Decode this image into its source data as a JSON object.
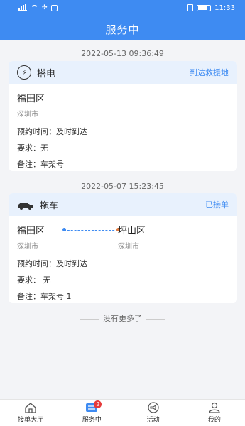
{
  "status_bar": {
    "time": "11:33"
  },
  "header": {
    "title": "服务中"
  },
  "orders": [
    {
      "timestamp": "2022-05-13 09:36:49",
      "service": "搭电",
      "status": "到达救援地",
      "from": {
        "district": "福田区",
        "city": "深圳市"
      },
      "appointment_label": "预约时间：",
      "appointment_value": "及时到达",
      "requirement_label": "要求：",
      "requirement_value": "无",
      "note_label": "备注：",
      "note_value": "车架号"
    },
    {
      "timestamp": "2022-05-07 15:23:45",
      "service": "拖车",
      "status": "已接单",
      "from": {
        "district": "福田区",
        "city": "深圳市"
      },
      "to": {
        "district": "坪山区",
        "city": "深圳市"
      },
      "appointment_label": "预约时间：",
      "appointment_value": "及时到达",
      "requirement_label": "要求：",
      "requirement_value": " 无",
      "note_label": "备注：",
      "note_value": "车架号 1"
    }
  ],
  "list_end": "没有更多了",
  "tabs": [
    {
      "label": "接单大厅",
      "icon": "home-icon"
    },
    {
      "label": "服务中",
      "icon": "list-icon",
      "badge": "2",
      "active": true
    },
    {
      "label": "活动",
      "icon": "megaphone-icon"
    },
    {
      "label": "我的",
      "icon": "user-icon"
    }
  ],
  "colors": {
    "primary": "#3e8bf2",
    "badge": "#e63b3b",
    "card_header": "#e8f1fd"
  }
}
